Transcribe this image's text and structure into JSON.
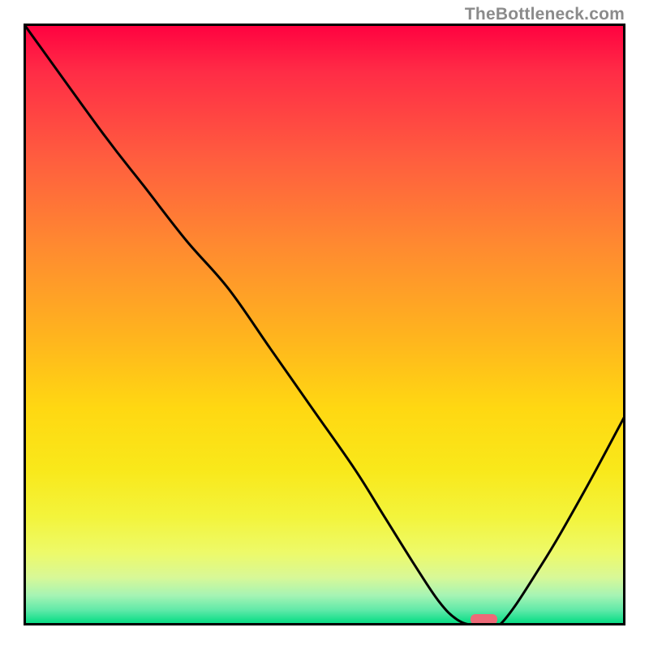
{
  "watermark": {
    "text": "TheBottleneck.com"
  },
  "chart_data": {
    "type": "line",
    "title": "",
    "xlabel": "",
    "ylabel": "",
    "xlim": [
      0,
      100
    ],
    "ylim": [
      0,
      100
    ],
    "grid": false,
    "legend": false,
    "series": [
      {
        "name": "bottleneck-curve",
        "x": [
          0,
          13,
          20,
          27,
          34,
          41,
          48,
          55,
          60,
          65,
          69,
          72,
          75,
          79,
          86,
          93,
          100
        ],
        "values": [
          100,
          82,
          73,
          64,
          56,
          46,
          36,
          26,
          18,
          10,
          4,
          1,
          0,
          0,
          10,
          22,
          35
        ]
      }
    ],
    "background_gradient": {
      "stops": [
        {
          "pct": 0,
          "color": "#ff0040"
        },
        {
          "pct": 50,
          "color": "#ffb41e"
        },
        {
          "pct": 85,
          "color": "#f3f43c"
        },
        {
          "pct": 100,
          "color": "#00d97f"
        }
      ]
    },
    "minimum_marker": {
      "x_pct": 76.5,
      "width_pct": 4.5,
      "color": "#ed6a78"
    }
  }
}
